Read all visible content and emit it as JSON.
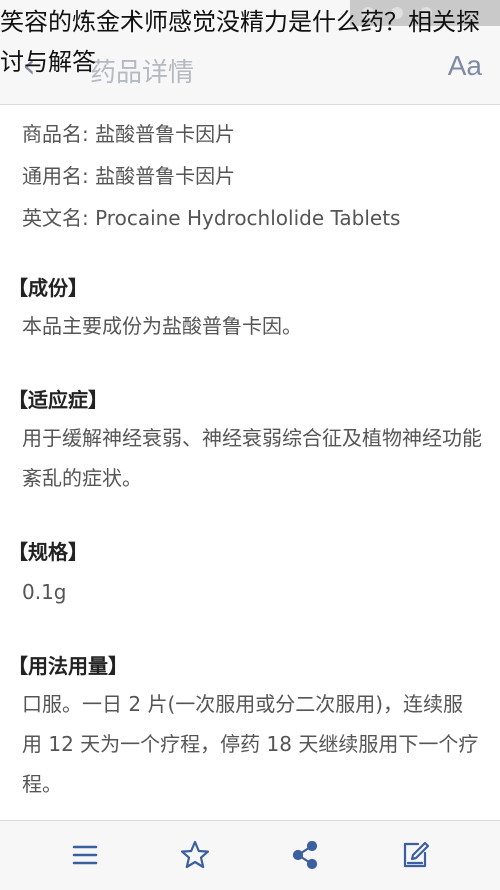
{
  "overlay_caption": "笑容的炼金术师感觉没精力是什么药？相关探讨与解答",
  "nav": {
    "title": "药品详情",
    "font_button": "Aa"
  },
  "drug": {
    "trade_name": "商品名: 盐酸普鲁卡因片",
    "generic_name": "通用名: 盐酸普鲁卡因片",
    "english_name": "英文名: Procaine Hydrochlolide Tablets"
  },
  "sections": {
    "composition": {
      "heading": "【成份】",
      "text": "本品主要成份为盐酸普鲁卡因。"
    },
    "indications": {
      "heading": "【适应症】",
      "text": "用于缓解神经衰弱、神经衰弱综合征及植物神经功能紊乱的症状。"
    },
    "specification": {
      "heading": "【规格】",
      "text": "0.1g"
    },
    "dosage": {
      "heading": "【用法用量】",
      "text": "口服。一日 2 片(一次服用或分二次服用)，连续服用 12 天为一个疗程，停药 18 天继续服用下一个疗程。"
    }
  },
  "tabbar": {
    "icons": [
      "menu-icon",
      "star-icon",
      "share-icon",
      "edit-icon"
    ],
    "accent_color": "#3b5f9f"
  }
}
